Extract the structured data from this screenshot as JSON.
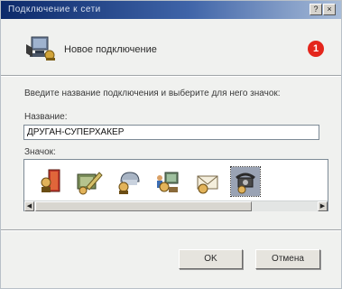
{
  "window": {
    "title": "Подключение к сети"
  },
  "header": {
    "text": "Новое подключение"
  },
  "badge": "1",
  "description": "Введите название подключения и выберите для него значок:",
  "name_field": {
    "label": "Название:",
    "value": "ДРУГАН-СУПЕРХАКЕР"
  },
  "icons_field": {
    "label": "Значок:",
    "icons": [
      "door-icon",
      "pencil-computer-icon",
      "phone-network-icon",
      "computer-people-icon",
      "envelope-icon",
      "phone-icon"
    ],
    "selected_index": 5
  },
  "buttons": {
    "ok": "OK",
    "cancel": "Отмена"
  }
}
